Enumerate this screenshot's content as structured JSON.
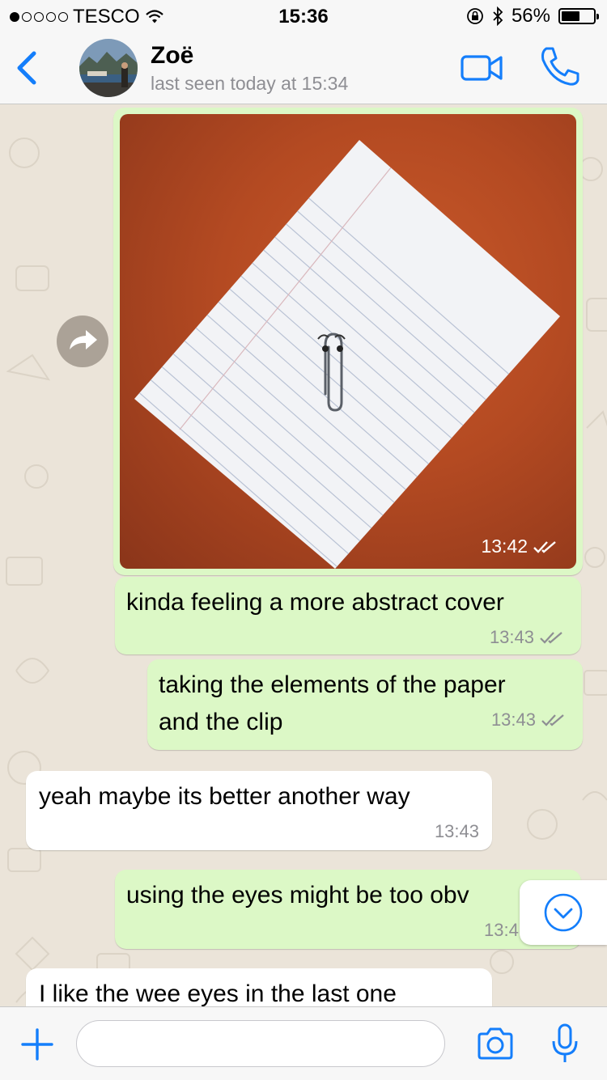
{
  "status_bar": {
    "carrier": "TESCO",
    "time": "15:36",
    "battery": "56%",
    "battery_level": 0.56
  },
  "header": {
    "contact_name": "Zoë",
    "last_seen": "last seen today at 15:34"
  },
  "messages": [
    {
      "type": "image",
      "direction": "outgoing",
      "time": "13:42",
      "image_alt": "paper clip with eyes on lined paper"
    },
    {
      "type": "text",
      "direction": "outgoing",
      "lines": [
        "kinda feeling a more abstract cover"
      ],
      "time": "13:43"
    },
    {
      "type": "text",
      "direction": "outgoing",
      "lines": [
        "taking the elements of the paper",
        "and the clip"
      ],
      "time": "13:43"
    },
    {
      "type": "text",
      "direction": "incoming",
      "lines": [
        "yeah maybe its better another way"
      ],
      "time": "13:43"
    },
    {
      "type": "text",
      "direction": "outgoing",
      "lines": [
        "using the eyes might be too obv"
      ],
      "time": "13:4"
    },
    {
      "type": "text",
      "direction": "incoming",
      "lines": [
        "I like the wee eyes in the last one"
      ]
    }
  ],
  "input": {
    "placeholder": ""
  },
  "colors": {
    "accent": "#147efb",
    "outgoing_bubble": "#dcf8c6",
    "incoming_bubble": "#ffffff",
    "chat_background": "#ebe4d9"
  }
}
